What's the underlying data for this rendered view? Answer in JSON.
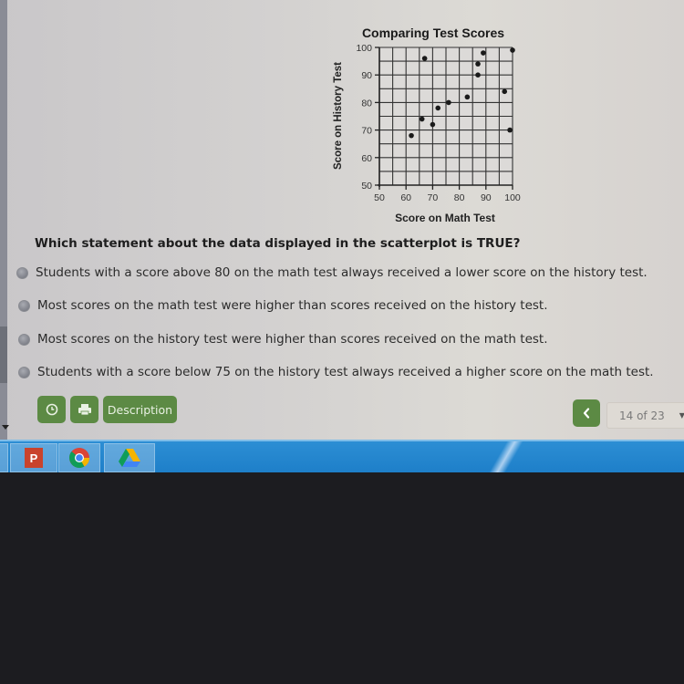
{
  "question": {
    "text": "Which statement about the data displayed in the scatterplot is TRUE?",
    "options": [
      {
        "label": "Students with a score above 80 on the math test always received a lower score on the history test.",
        "selected": false
      },
      {
        "label": "Most scores on the math test were higher than scores received on the history test.",
        "selected": false
      },
      {
        "label": "Most scores on the history test were higher than scores received on the math test.",
        "selected": false
      },
      {
        "label": "Students with a score below 75 on the history test always received a higher score on the math test.",
        "selected": false
      }
    ]
  },
  "toolbar": {
    "timer_icon": "clock-icon",
    "print_icon": "printer-icon",
    "description_label": "Description",
    "prev_icon": "chevron-left-icon",
    "page_indicator": "14 of 23",
    "dropdown_icon": "caret-down-icon",
    "accent_color": "#5c8a44"
  },
  "taskbar": {
    "apps": [
      {
        "name": "PowerPoint",
        "icon": "powerpoint-icon",
        "glyph": "P"
      },
      {
        "name": "Chrome",
        "icon": "chrome-icon"
      },
      {
        "name": "Google Drive",
        "icon": "google-drive-icon"
      }
    ]
  },
  "chart_data": {
    "type": "scatter",
    "title": "Comparing Test Scores",
    "xlabel": "Score on Math Test",
    "ylabel": "Score on History Test",
    "xlim": [
      50,
      100
    ],
    "ylim": [
      50,
      100
    ],
    "x_ticks": [
      50,
      60,
      70,
      80,
      90,
      100
    ],
    "y_ticks": [
      50,
      60,
      70,
      80,
      90,
      100
    ],
    "grid": true,
    "grid_step": 5,
    "legend": "none",
    "points": [
      {
        "x": 62,
        "y": 68
      },
      {
        "x": 66,
        "y": 74
      },
      {
        "x": 67,
        "y": 96
      },
      {
        "x": 70,
        "y": 72
      },
      {
        "x": 72,
        "y": 78
      },
      {
        "x": 76,
        "y": 80
      },
      {
        "x": 83,
        "y": 82
      },
      {
        "x": 87,
        "y": 90
      },
      {
        "x": 87,
        "y": 94
      },
      {
        "x": 89,
        "y": 98
      },
      {
        "x": 97,
        "y": 84
      },
      {
        "x": 99,
        "y": 70
      },
      {
        "x": 100,
        "y": 99
      }
    ]
  }
}
